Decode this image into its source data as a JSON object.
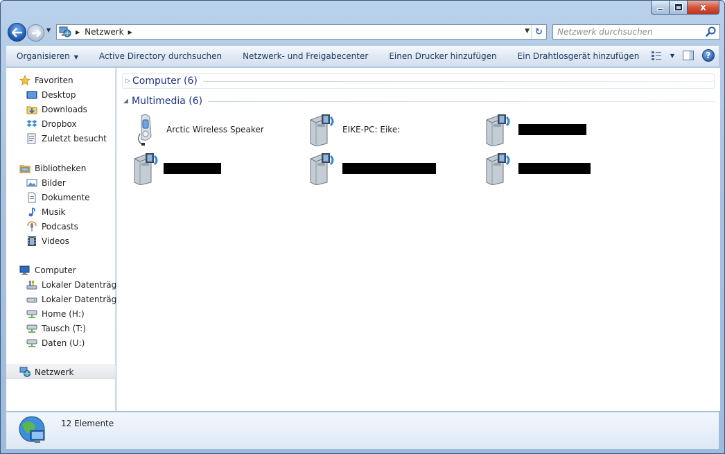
{
  "window": {
    "caption_buttons": {
      "minimize": "",
      "maximize": "",
      "close": "x"
    }
  },
  "navbar": {
    "breadcrumb": "Netzwerk",
    "search_placeholder": "Netzwerk durchsuchen"
  },
  "commandbar": {
    "items": [
      {
        "label": "Organisieren",
        "has_dropdown": true
      },
      {
        "label": "Active Directory durchsuchen"
      },
      {
        "label": "Netzwerk- und Freigabecenter"
      },
      {
        "label": "Einen Drucker hinzufügen"
      },
      {
        "label": "Ein Drahtlosgerät hinzufügen"
      }
    ],
    "help_label": "?"
  },
  "sidebar": {
    "favorites": {
      "label": "Favoriten",
      "icon": "star-icon",
      "items": [
        {
          "label": "Desktop",
          "icon": "desktop-icon"
        },
        {
          "label": "Downloads",
          "icon": "downloads-folder-icon"
        },
        {
          "label": "Dropbox",
          "icon": "dropbox-icon"
        },
        {
          "label": "Zuletzt besucht",
          "icon": "recent-places-icon"
        }
      ]
    },
    "libraries": {
      "label": "Bibliotheken",
      "icon": "libraries-icon",
      "items": [
        {
          "label": "Bilder",
          "icon": "pictures-icon"
        },
        {
          "label": "Dokumente",
          "icon": "documents-icon"
        },
        {
          "label": "Musik",
          "icon": "music-icon"
        },
        {
          "label": "Podcasts",
          "icon": "podcast-icon"
        },
        {
          "label": "Videos",
          "icon": "videos-icon"
        }
      ]
    },
    "computer": {
      "label": "Computer",
      "icon": "computer-icon",
      "items": [
        {
          "label": "Lokaler Datenträger",
          "icon": "system-drive-icon"
        },
        {
          "label": "Lokaler Datenträger",
          "icon": "drive-icon"
        },
        {
          "label": "Home (H:)",
          "icon": "network-drive-icon"
        },
        {
          "label": "Tausch (T:)",
          "icon": "network-drive-icon"
        },
        {
          "label": "Daten (U:)",
          "icon": "network-drive-icon"
        }
      ]
    },
    "network": {
      "label": "Netzwerk",
      "icon": "network-icon"
    }
  },
  "main": {
    "groups": [
      {
        "title": "Computer (6)",
        "expanded": false
      },
      {
        "title": "Multimedia (6)",
        "expanded": true
      }
    ],
    "devices": [
      {
        "label": "Arctic Wireless Speaker",
        "icon": "media-player-icon",
        "redacted": false
      },
      {
        "label": "EIKE-PC: Eike:",
        "icon": "media-server-icon",
        "redacted": false
      },
      {
        "label": "",
        "icon": "media-server-icon",
        "redacted": true
      },
      {
        "label": "",
        "icon": "media-server-icon",
        "redacted": true
      },
      {
        "label": "",
        "icon": "media-server-icon",
        "redacted": true
      },
      {
        "label": "",
        "icon": "media-server-icon",
        "redacted": true
      }
    ]
  },
  "status": {
    "text": "12 Elemente",
    "icon": "network-globe-icon"
  },
  "colors": {
    "group_title": "#1e3287",
    "accent": "#2e6fb6"
  }
}
